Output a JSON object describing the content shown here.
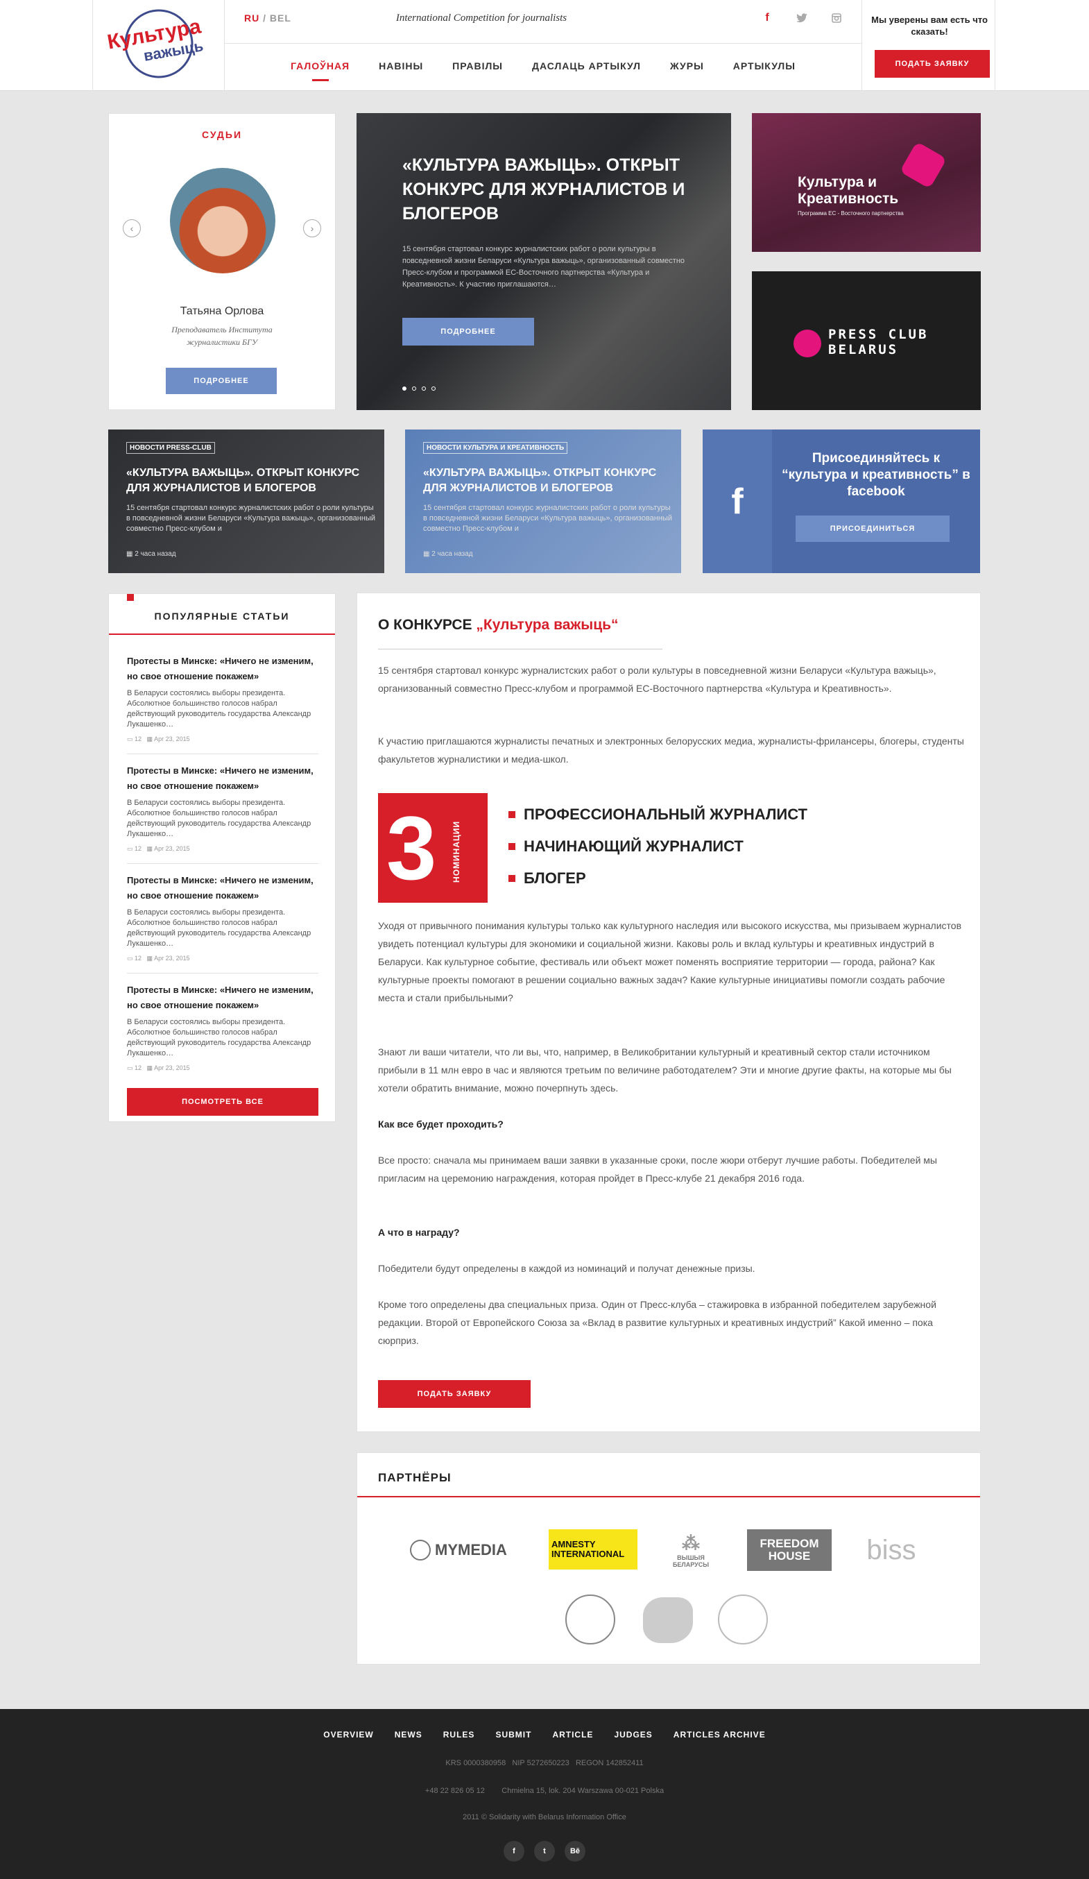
{
  "header": {
    "logo_line1": "Культура",
    "logo_line2": "важыць",
    "lang_ru": "RU",
    "lang_sep": "/",
    "lang_bel": "BEL",
    "tagline": "International Competition for journalists",
    "social": [
      "f",
      "t",
      "ig"
    ],
    "nav": [
      "ГАЛОЎНАЯ",
      "НАВІНЫ",
      "ПРАВІЛЫ",
      "ДАСЛАЦЬ АРТЫКУЛ",
      "ЖУРЫ",
      "АРТЫКУЛЫ"
    ],
    "nav_active": 0,
    "question": "Мы уверены вам есть что сказать!",
    "apply_button": "ПОДАТЬ ЗАЯВКУ"
  },
  "judges": {
    "title": "СУДЬИ",
    "name": "Татьяна Орлова",
    "role": "Преподаватель Института журналистики БГУ",
    "button": "ПОДРОБНЕЕ"
  },
  "hero": {
    "title": "«КУЛЬТУРА ВАЖЫЦЬ». ОТКРЫТ КОНКУРС ДЛЯ ЖУРНАЛИСТОВ И БЛОГЕРОВ",
    "description": "15 сентября стартовал конкурс журналистских работ о роли культуры в повседневной жизни Беларуси «Культура важыць», организованный совместно Пресс-клубом и программой ЕС-Восточного партнерства «Культура и Креативность». К участию приглашаются…",
    "button": "ПОДРОБНЕЕ",
    "slides": 4,
    "active_slide": 0
  },
  "promo1": {
    "title": "Культура и Креативность",
    "subtitle": "Программа ЕС - Восточного партнерства"
  },
  "promo2": {
    "title": "PRESS CLUB BELARUS"
  },
  "news": [
    {
      "tag": "НОВОСТИ PRESS-CLUB",
      "title": "«КУЛЬТУРА ВАЖЫЦЬ». ОТКРЫТ КОНКУРС ДЛЯ ЖУРНАЛИСТОВ И БЛОГЕРОВ",
      "description": "15 сентября стартовал конкурс журналистских работ о роли культуры в повседневной жизни Беларуси «Культура важыць», организованный совместно Пресс-клубом и",
      "time": "2 часа назад"
    },
    {
      "tag": "НОВОСТИ КУЛЬТУРА И КРЕАТИВНОСТЬ",
      "title": "«КУЛЬТУРА ВАЖЫЦЬ». ОТКРЫТ КОНКУРС ДЛЯ ЖУРНАЛИСТОВ И БЛОГЕРОВ",
      "description": "15 сентября стартовал конкурс журналистских работ о роли культуры в повседневной жизни Беларуси «Культура важыць», организованный совместно Пресс-клубом и",
      "time": "2 часа назад"
    }
  ],
  "facebook": {
    "icon": "f",
    "title": "Присоединяйтесь к “культура и креативность” в facebook",
    "button": "ПРИСОЕДИНИТЬСЯ"
  },
  "popular": {
    "title": "ПОПУЛЯРНЫЕ СТАТЬИ",
    "items": [
      {
        "title": "Протесты в Минске: «Ничего не изменим, но свое отношение покажем»",
        "text": "В Беларуси состоялись выборы президента. Абсолютное большинство голосов набрал действующий руководитель государства Александр Лукашенко…",
        "comments": "12",
        "date": "Apr 23, 2015"
      },
      {
        "title": "Протесты в Минске: «Ничего не изменим, но свое отношение покажем»",
        "text": "В Беларуси состоялись выборы президента. Абсолютное большинство голосов набрал действующий руководитель государства Александр Лукашенко…",
        "comments": "12",
        "date": "Apr 23, 2015"
      },
      {
        "title": "Протесты в Минске: «Ничего не изменим, но свое отношение покажем»",
        "text": "В Беларуси состоялись выборы президента. Абсолютное большинство голосов набрал действующий руководитель государства Александр Лукашенко…",
        "comments": "12",
        "date": "Apr 23, 2015"
      },
      {
        "title": "Протесты в Минске: «Ничего не изменим, но свое отношение покажем»",
        "text": "В Беларуси состоялись выборы президента. Абсолютное большинство голосов набрал действующий руководитель государства Александр Лукашенко…",
        "comments": "12",
        "date": "Apr 23, 2015"
      }
    ],
    "button": "ПОСМОТРЕТЬ ВСЕ"
  },
  "about": {
    "title_prefix": "О КОНКУРСЕ",
    "title_accent": "„Культура важыць“",
    "p1": "15 сентября стартовал конкурс журналистских работ о роли культуры в повседневной жизни Беларуси «Культура важыць», организованный совместно Пресс-клубом и программой ЕС-Восточного партнерства «Культура и Креативность».",
    "p2": "К участию приглашаются журналисты печатных и электронных белорусских медиа, журналисты-фрилансеры, блогеры, студенты факультетов журналистики и медиа-школ.",
    "nominations_count": "3",
    "nominations_word": "НОМИНАЦИИ",
    "nominations": [
      "ПРОФЕССИОНАЛЬНЫЙ ЖУРНАЛИСТ",
      "НАЧИНАЮЩИЙ ЖУРНАЛИСТ",
      "БЛОГЕР"
    ],
    "p3": "Уходя от привычного понимания культуры только как культурного наследия или высокого искусства, мы призываем журналистов увидеть потенциал культуры для экономики и социальной жизни. Каковы роль и вклад культуры и креативных индустрий в  Беларуси. Как культурное событие, фестиваль или объект может поменять восприятие территории — города, района? Как культурные проекты помогают в решении социально важных задач? Какие культурные инициативы помогли создать рабочие места и стали прибыльными?",
    "p4": "Знают ли ваши читатели, что ли вы, что, например, в Великобритании культурный и креативный сектор стали источником прибыли в 11 млн евро в час и являются третьим по величине работодателем? Эти и многие другие факты, на которые мы бы хотели обратить внимание, можно почерпнуть здесь.",
    "q1": "Как все будет проходить?",
    "p5": "Все просто: сначала мы принимаем ваши заявки в указанные сроки, после жюри отберут лучшие работы. Победителей мы пригласим на церемонию награждения, которая пройдет в Пресс-клубе 21 декабря 2016 года.",
    "q2": "А что в награду?",
    "p6": "Победители будут определены в каждой из номинаций и получат  денежные призы.",
    "p7": "Кроме того определены два специальных приза. Один от Пресс-клуба – стажировка в избранной победителем зарубежной редакции. Второй от Европейского Союза за «Вклад в развитие культурных и креативных индустрий” Какой именно – пока сюрприз.",
    "button": "ПОДАТЬ ЗАЯВКУ"
  },
  "partners": {
    "title": "ПАРТНЁРЫ",
    "logos": [
      "MYMEDIA",
      "AMNESTY INTERNATIONAL",
      "ВЫШЫЯ БЕЛАРУСЫ",
      "FREEDOM HOUSE",
      "biss"
    ]
  },
  "footer": {
    "nav": [
      "OVERVIEW",
      "NEWS",
      "RULES",
      "SUBMIT",
      "ARTICLE",
      "JUDGES",
      "ARTICLES ARCHIVE"
    ],
    "ids": "KRS 0000380958   NIP 5272650223   REGON 142852411",
    "contact": "+48 22 826 05 12        Chmielna 15, lok. 204 Warszawa 00-021 Polska",
    "copyright": "2011 © Solidarity with Belarus Information Office",
    "social": [
      "f",
      "t",
      "Bē"
    ]
  },
  "colors": {
    "accent": "#d71f2a",
    "blue": "#6f8ec8",
    "facebook": "#4c6aa8",
    "footer": "#232323"
  }
}
